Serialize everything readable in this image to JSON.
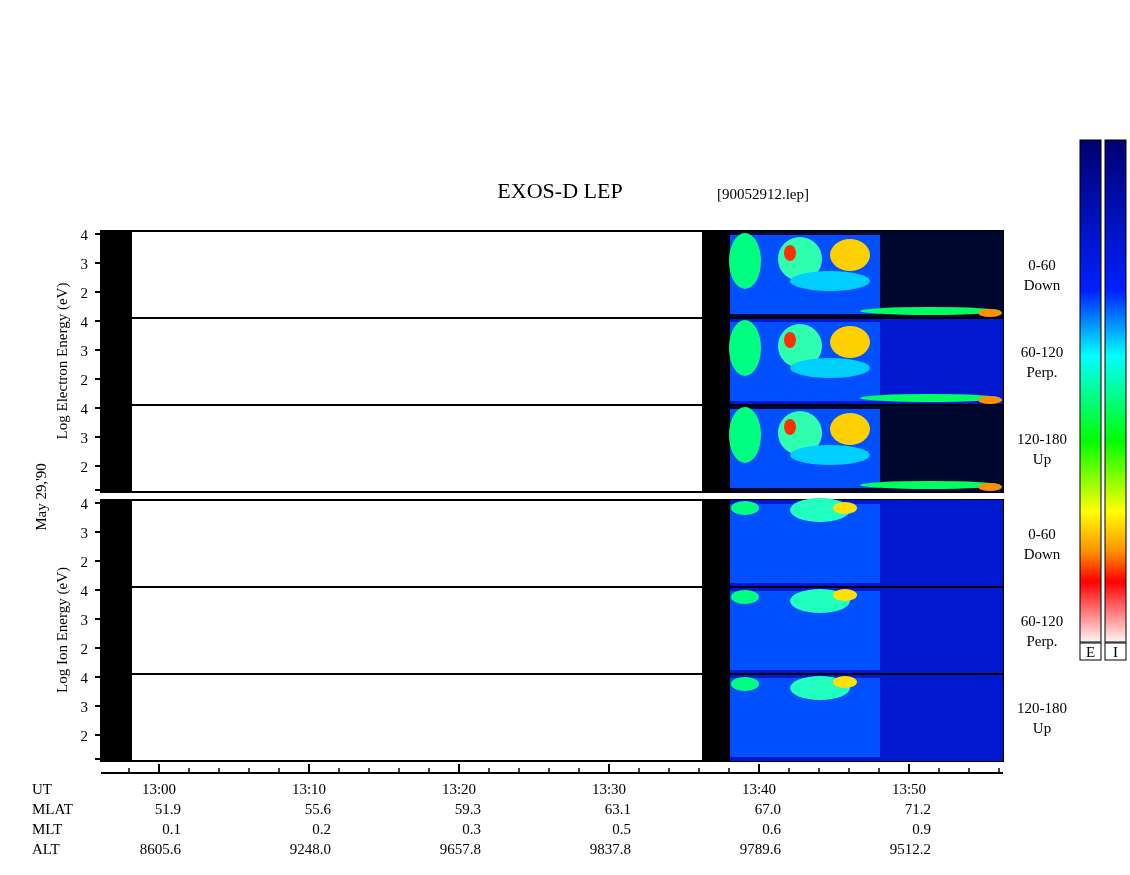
{
  "title": "EXOS-D LEP",
  "file": "[90052912.lep]",
  "date": "May 29,'90",
  "panels": [
    {
      "kind": "electron",
      "axis_label": "Log  Electron  Energy (eV)",
      "subpanels": [
        {
          "yticks": [
            "4",
            "3",
            "2"
          ],
          "range": "0-60",
          "direction": "Down"
        },
        {
          "yticks": [
            "4",
            "3",
            "2"
          ],
          "range": "60-120",
          "direction": "Perp."
        },
        {
          "yticks": [
            "4",
            "3",
            "2"
          ],
          "range": "120-180",
          "direction": "Up"
        }
      ]
    },
    {
      "kind": "ion",
      "axis_label": "Log  Ion  Energy (eV)",
      "subpanels": [
        {
          "yticks": [
            "4",
            "3",
            "2"
          ],
          "range": "0-60",
          "direction": "Down"
        },
        {
          "yticks": [
            "4",
            "3",
            "2"
          ],
          "range": "60-120",
          "direction": "Perp."
        },
        {
          "yticks": [
            "4",
            "3",
            "2"
          ],
          "range": "120-180",
          "direction": "Up"
        }
      ]
    }
  ],
  "colorbars": [
    {
      "label": "E"
    },
    {
      "label": "I"
    }
  ],
  "orbit_table": [
    {
      "label": "UT",
      "values": [
        "13:00",
        "13:10",
        "13:20",
        "13:30",
        "13:40",
        "13:50"
      ]
    },
    {
      "label": "MLAT",
      "values": [
        "51.9",
        "55.6",
        "59.3",
        "63.1",
        "67.0",
        "71.2"
      ]
    },
    {
      "label": "MLT",
      "values": [
        "0.1",
        "0.2",
        "0.3",
        "0.5",
        "0.6",
        "0.9"
      ]
    },
    {
      "label": "ALT",
      "values": [
        "8605.6",
        "9248.0",
        "9657.8",
        "9837.8",
        "9789.6",
        "9512.2"
      ]
    }
  ]
}
